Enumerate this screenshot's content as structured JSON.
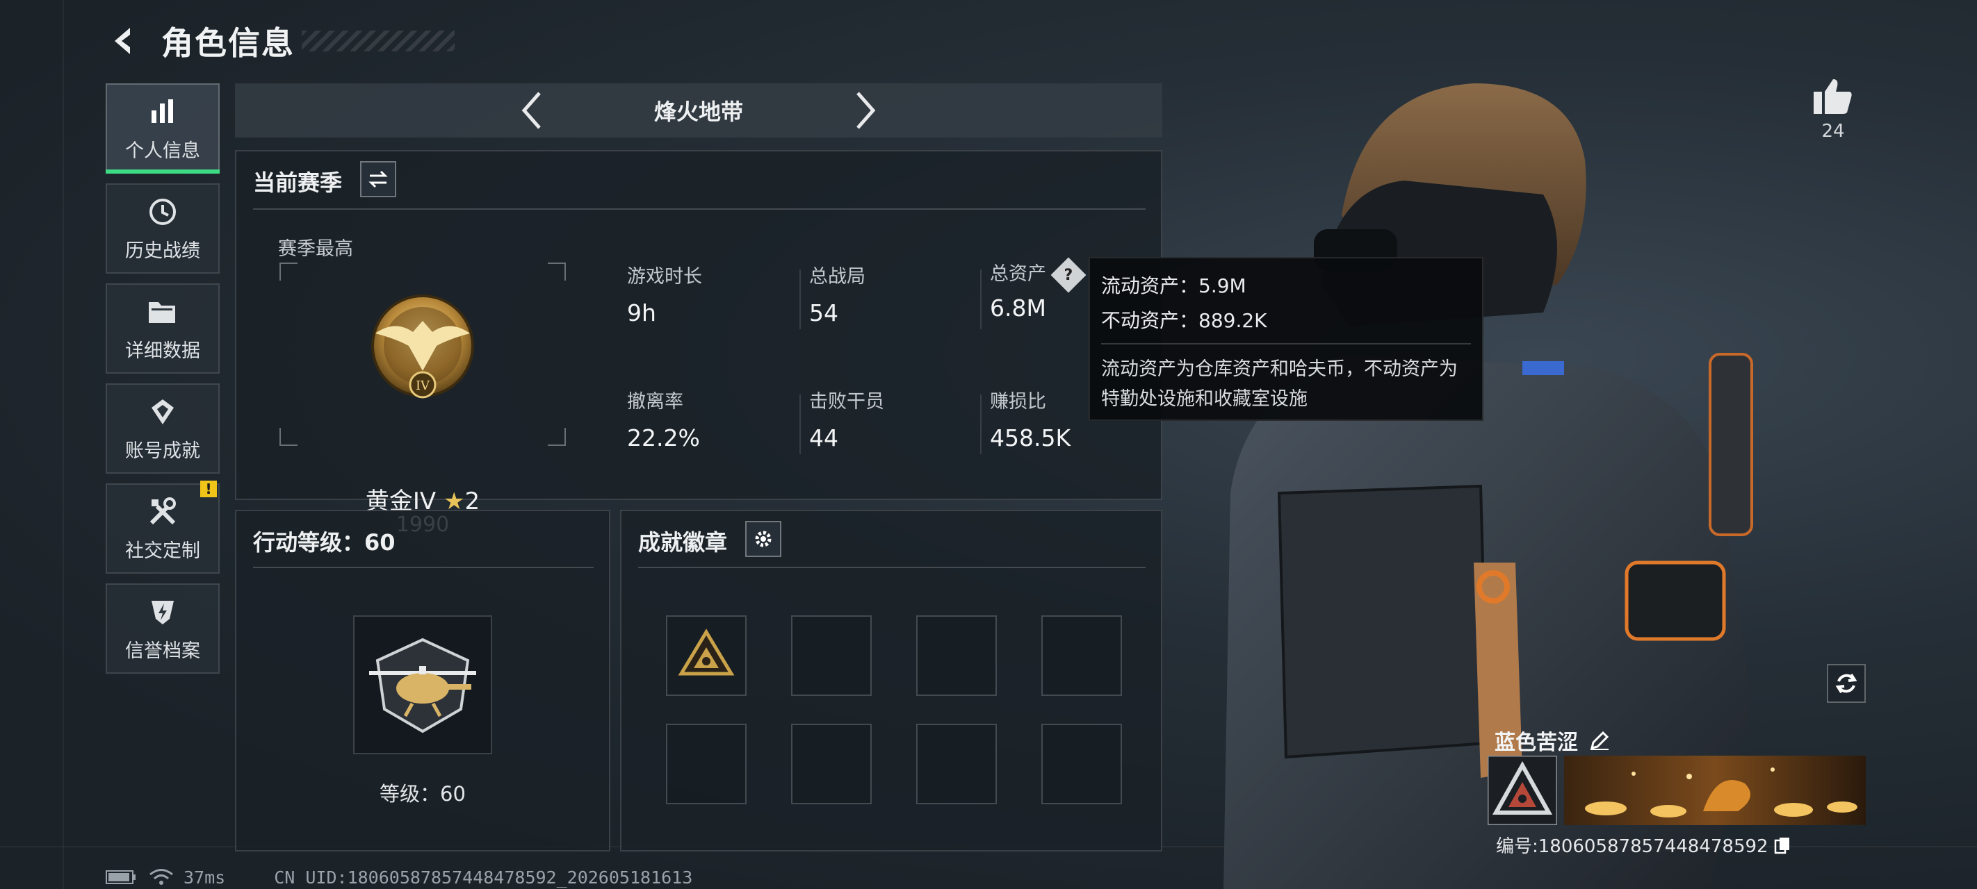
{
  "header": {
    "title": "角色信息"
  },
  "sidebar": {
    "items": [
      {
        "label": "个人信息",
        "icon": "bar-chart-icon",
        "active": true
      },
      {
        "label": "历史战绩",
        "icon": "history-icon"
      },
      {
        "label": "详细数据",
        "icon": "folder-icon"
      },
      {
        "label": "账号成就",
        "icon": "achievement-icon"
      },
      {
        "label": "社交定制",
        "icon": "tools-icon",
        "badge": "!"
      },
      {
        "label": "信誉档案",
        "icon": "shield-bolt-icon"
      }
    ]
  },
  "mode": {
    "name": "烽火地带"
  },
  "season": {
    "title": "当前赛季",
    "best_label": "赛季最高",
    "rank_name": "黄金IV",
    "rank_stars": "2",
    "rank_score": "1990",
    "stats": [
      {
        "label": "游戏时长",
        "value": "9h"
      },
      {
        "label": "总战局",
        "value": "54"
      },
      {
        "label": "总资产",
        "value": "6.8M"
      },
      {
        "label": "撤离率",
        "value": "22.2%"
      },
      {
        "label": "击败干员",
        "value": "44"
      },
      {
        "label": "赚损比",
        "value": "458.5K"
      }
    ]
  },
  "tooltip": {
    "liquid": "流动资产：5.9M",
    "fixed": "不动资产：889.2K",
    "desc": "流动资产为仓库资产和哈夫币，不动资产为特勤处设施和收藏室设施"
  },
  "action_level": {
    "title": "行动等级：60",
    "caption": "等级：60"
  },
  "badges": {
    "title": "成就徽章"
  },
  "status": {
    "ping": "37ms",
    "uid": "CN UID:18060587857448478592_202605181613"
  },
  "like": {
    "count": "24"
  },
  "player": {
    "name": "蓝色苦涩",
    "id": "编号:18060587857448478592"
  },
  "colors": {
    "accent_green": "#3ddc84",
    "badge_yellow": "#f0c419",
    "gold": "#c9a24a"
  }
}
